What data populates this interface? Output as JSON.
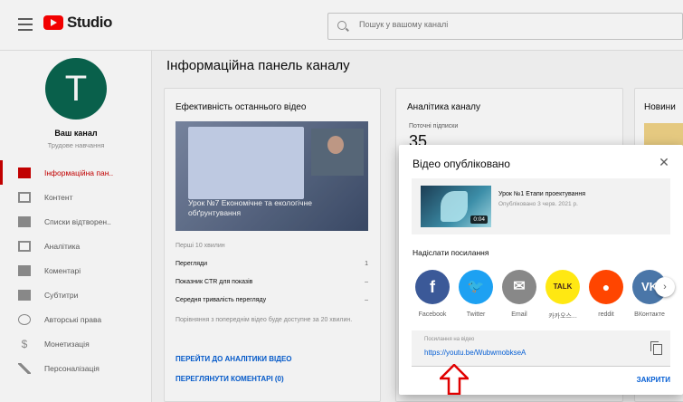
{
  "app": {
    "logo_text": "Studio",
    "search_placeholder": "Пошук у вашому каналі"
  },
  "sidebar": {
    "avatar_letter": "T",
    "channel_name": "Ваш канал",
    "channel_subtitle": "Трудове навчання",
    "items": [
      {
        "label": "Інформаційна пан..",
        "icon": "dashboard-icon",
        "active": true
      },
      {
        "label": "Контент",
        "icon": "content-icon",
        "active": false
      },
      {
        "label": "Списки відтворен..",
        "icon": "playlists-icon",
        "active": false
      },
      {
        "label": "Аналітика",
        "icon": "analytics-icon",
        "active": false
      },
      {
        "label": "Коментарі",
        "icon": "comments-icon",
        "active": false
      },
      {
        "label": "Субтитри",
        "icon": "subtitles-icon",
        "active": false
      },
      {
        "label": "Авторські права",
        "icon": "copyright-icon",
        "active": false
      },
      {
        "label": "Монетизація",
        "icon": "monetization-icon",
        "active": false
      },
      {
        "label": "Персоналізація",
        "icon": "customization-icon",
        "active": false
      }
    ]
  },
  "main": {
    "page_title": "Інформаційна панель каналу",
    "latest_video_card": {
      "title": "Ефективність останнього відео",
      "thumb_title": "Урок №7 Економічне та екологічне обґрунтування",
      "period": "Перші 10 хвилин",
      "stats": [
        {
          "label": "Перегляди",
          "value": "1"
        },
        {
          "label": "Показник CTR для показів",
          "value": "–"
        },
        {
          "label": "Середня тривалість перегляду",
          "value": "–"
        }
      ],
      "compare_note": "Порівняння з попереднім відео буде доступне за 20 хвилин.",
      "link_analytics": "ПЕРЕЙТИ ДО АНАЛІТИКИ ВІДЕО",
      "link_comments": "ПЕРЕГЛЯНУТИ КОМЕНТАРІ (0)"
    },
    "analytics_card": {
      "title": "Аналітика каналу",
      "subtitle": "Поточні підписки",
      "subscribers": "35"
    },
    "news_card": {
      "title": "Новини"
    }
  },
  "dialog": {
    "title": "Відео опубліковано",
    "video_title": "Урок №1 Етапи проектування",
    "video_date": "Опубліковано 3 черв. 2021 р.",
    "video_duration": "0:04",
    "share_label": "Надіслати посилання",
    "share_options": [
      {
        "name": "Facebook",
        "icon": "facebook-icon",
        "glyph": "f",
        "color": "#3b5998",
        "text_color": "#ffffff"
      },
      {
        "name": "Twitter",
        "icon": "twitter-icon",
        "glyph": "🐦",
        "color": "#1da1f2",
        "text_color": "#ffffff"
      },
      {
        "name": "Email",
        "icon": "email-icon",
        "glyph": "✉",
        "color": "#888888",
        "text_color": "#ffffff"
      },
      {
        "name": "카카오스...",
        "icon": "kakaotalk-icon",
        "glyph": "TALK",
        "color": "#ffe812",
        "text_color": "#3c1e1e"
      },
      {
        "name": "reddit",
        "icon": "reddit-icon",
        "glyph": "●",
        "color": "#ff4500",
        "text_color": "#ffffff"
      },
      {
        "name": "ВКонтакте",
        "icon": "vk-icon",
        "glyph": "VK",
        "color": "#4a76a8",
        "text_color": "#ffffff"
      }
    ],
    "link_label": "Посилання на відео",
    "link_value": "https://youtu.be/WubwmobkseA",
    "done_label": "ЗАКРИТИ"
  },
  "colors": {
    "accent_red": "#cc0000",
    "link_blue": "#065fd4",
    "annotation_arrow": "#e00000"
  }
}
